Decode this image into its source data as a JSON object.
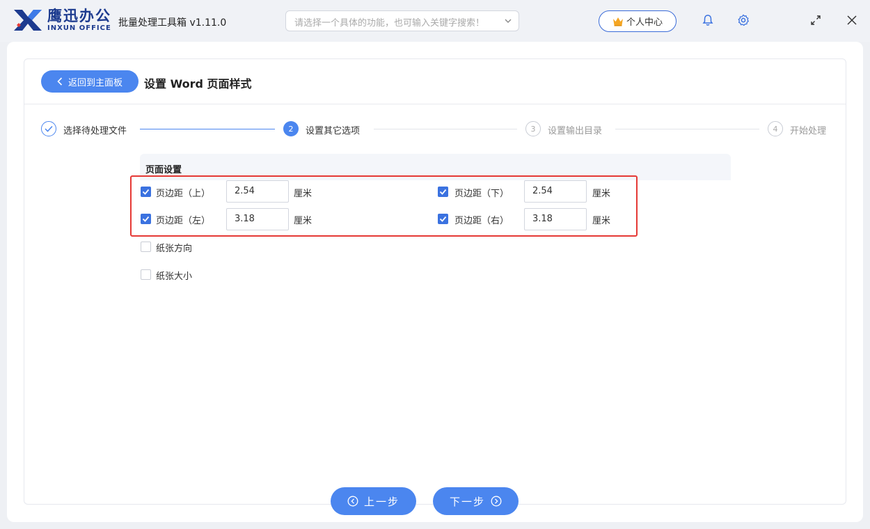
{
  "header": {
    "brand_cn": "鹰迅办公",
    "brand_en": "INXUN OFFICE",
    "app_title": "批量处理工具箱 v1.11.0",
    "search_placeholder": "请选择一个具体的功能，也可输入关键字搜索！",
    "user_center_label": "个人中心",
    "icons": [
      "crown-icon",
      "bell-icon",
      "gear-icon",
      "maximize-icon",
      "close-icon"
    ]
  },
  "page": {
    "back_label": "返回到主面板",
    "title": "设置 Word 页面样式"
  },
  "steps": [
    {
      "number": "1",
      "label": "选择待处理文件",
      "state": "done"
    },
    {
      "number": "2",
      "label": "设置其它选项",
      "state": "active"
    },
    {
      "number": "3",
      "label": "设置输出目录",
      "state": "pending"
    },
    {
      "number": "4",
      "label": "开始处理",
      "state": "pending"
    }
  ],
  "section": {
    "title": "页面设置",
    "margins": {
      "top": {
        "label": "页边距（上）",
        "value": "2.54",
        "unit": "厘米",
        "checked": true
      },
      "bottom": {
        "label": "页边距（下）",
        "value": "2.54",
        "unit": "厘米",
        "checked": true
      },
      "left": {
        "label": "页边距（左）",
        "value": "3.18",
        "unit": "厘米",
        "checked": true
      },
      "right": {
        "label": "页边距（右）",
        "value": "3.18",
        "unit": "厘米",
        "checked": true
      }
    },
    "orientation": {
      "label": "纸张方向",
      "checked": false
    },
    "paper_size": {
      "label": "纸张大小",
      "checked": false
    }
  },
  "footer": {
    "prev_label": "上一步",
    "next_label": "下一步"
  },
  "colors": {
    "accent": "#4b86ef",
    "checkbox": "#3b72e0",
    "highlight": "#e53935",
    "brand": "#1d3b8f"
  }
}
